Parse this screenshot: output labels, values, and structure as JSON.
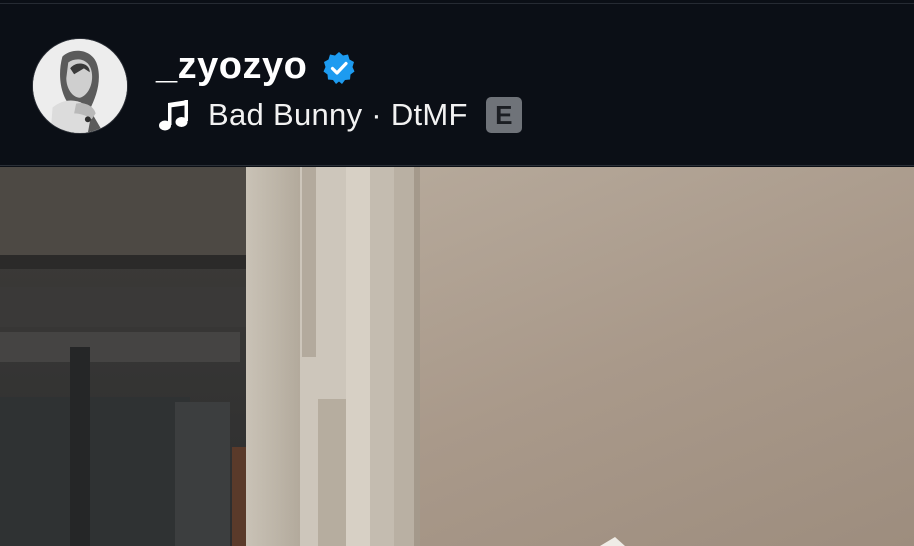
{
  "post_header": {
    "username": "_zyozyo",
    "verified": true,
    "music_label": "Bad Bunny · DtMF",
    "explicit_badge": "E"
  },
  "icons": {
    "avatar": "profile-avatar",
    "verified": "verified-badge-icon",
    "music": "music-note-icon"
  },
  "colors": {
    "background": "#0b0f16",
    "verified_blue": "#1d9bf0",
    "text": "#ffffff",
    "badge": "#6f7379"
  }
}
